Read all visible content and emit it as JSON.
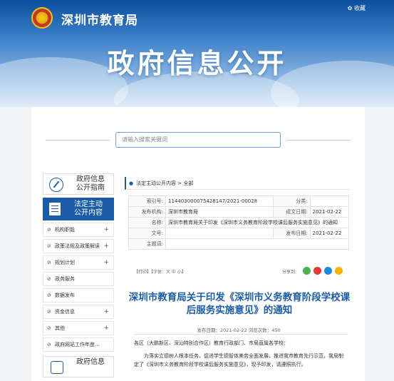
{
  "header": {
    "site_title": "深圳市教育局",
    "favorite": "收藏",
    "banner_title": "政府信息公开"
  },
  "search": {
    "placeholder": "请输入搜索关键词"
  },
  "sidebar": {
    "guide": "政府信息\n公开指南",
    "active": "法定主动\n公开内容",
    "items": [
      {
        "label": "机构职能",
        "expand": "+"
      },
      {
        "label": "政策法规及政策解读",
        "expand": "+"
      },
      {
        "label": "规划计划",
        "expand": "+"
      },
      {
        "label": "政务服务",
        "expand": ""
      },
      {
        "label": "数据发布",
        "expand": ""
      },
      {
        "label": "资金信息",
        "expand": "+"
      },
      {
        "label": "其他",
        "expand": "+"
      },
      {
        "label": "政府网站工作年度...",
        "expand": ""
      }
    ],
    "bottom": "政府信息"
  },
  "breadcrumb": {
    "section": "法定主动公开内容",
    "sep": ">",
    "current": "全部"
  },
  "meta": {
    "index_label": "索引号:",
    "index_value": "11440300007542814​7/2021-00028",
    "category_label": "分类:",
    "category_value": "",
    "publisher_label": "发布机构:",
    "publisher_value": "深圳市教育局",
    "created_label": "成文日期:",
    "created_value": "2021-02-22",
    "name_label": "名称:",
    "name_value": "深圳市教育局关于印发《深圳市义务教育阶段学校课后服务实施意见》的通知",
    "docno_label": "文号:",
    "docno_value": "",
    "pubdate_label": "发布日期:",
    "pubdate_value": "2021-02-22",
    "subject_label": "主题词:",
    "subject_value": ""
  },
  "tools": {
    "text": "【打印】【字体：大 中 小】",
    "share_label": "分享到:"
  },
  "article": {
    "title": "深圳市教育局关于印发《深圳市义务教育阶段学校课后服务实施意见》的通知",
    "meta": "发布日期：2021-02-22   浏览次数：450",
    "p1": "各区（大鹏新区、深汕特别合作区）教育行政部门、市局直属各学校：",
    "p2": "为落实立德树人根本任务，促进学生德智体美劳全面发展，推进我市教育先行示范，我局制定了《深圳市义务教育阶段学校课后服务实施意见》，现予印发，请遵照执行。"
  },
  "colors": {
    "primary": "#1a5ca8",
    "share1": "#4caf50",
    "share2": "#e53935",
    "share3": "#1e88e5",
    "share4": "#f6b400"
  }
}
